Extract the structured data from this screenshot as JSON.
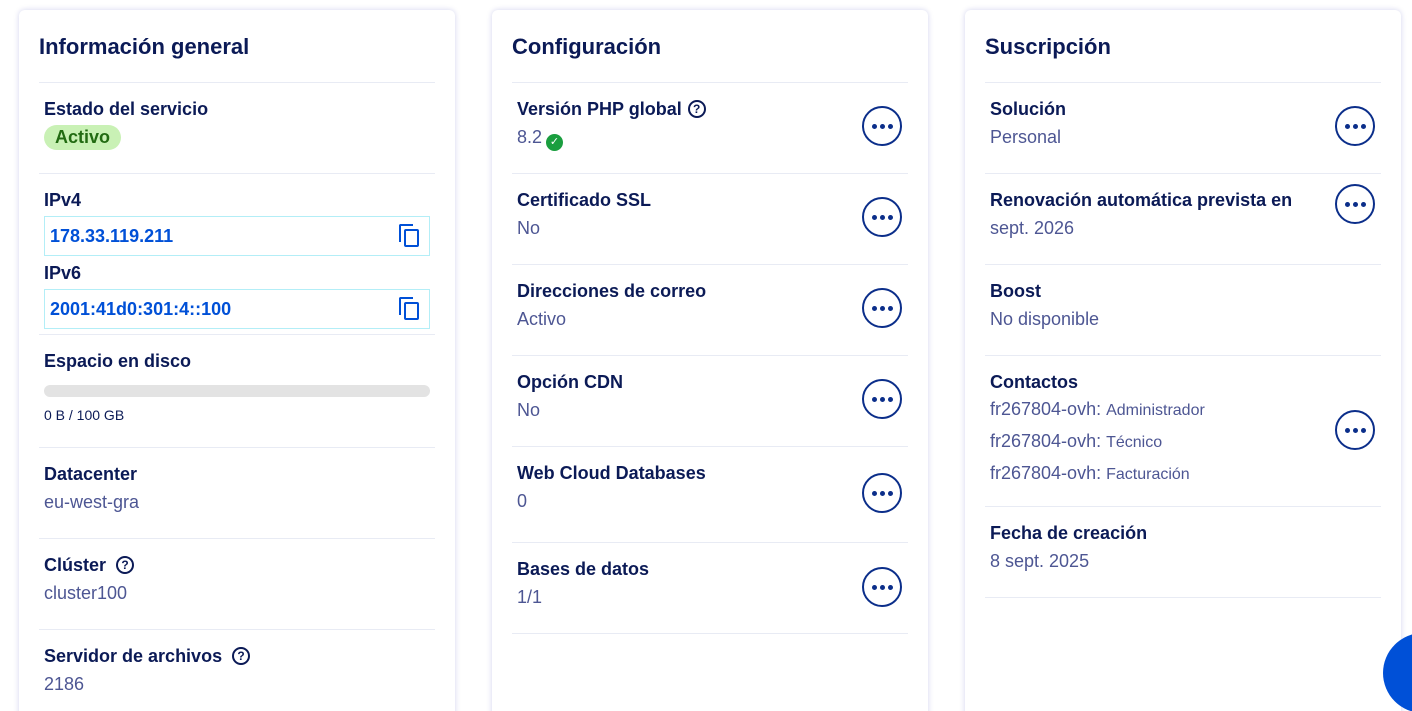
{
  "general": {
    "title": "Información general",
    "status": {
      "label": "Estado del servicio",
      "value": "Activo"
    },
    "ipv4": {
      "label": "IPv4",
      "value": "178.33.119.211"
    },
    "ipv6": {
      "label": "IPv6",
      "value": "2001:41d0:301:4::100"
    },
    "disk": {
      "label": "Espacio en disco",
      "usage_text": "0 B / 100 GB",
      "used_fraction": 0
    },
    "datacenter": {
      "label": "Datacenter",
      "value": "eu-west-gra"
    },
    "cluster": {
      "label": "Clúster",
      "value": "cluster100"
    },
    "fileserver": {
      "label": "Servidor de archivos",
      "value": "2186"
    }
  },
  "config": {
    "title": "Configuración",
    "php": {
      "label": "Versión PHP global",
      "value": "8.2"
    },
    "ssl": {
      "label": "Certificado SSL",
      "value": "No"
    },
    "mail": {
      "label": "Direcciones de correo",
      "value": "Activo"
    },
    "cdn": {
      "label": "Opción CDN",
      "value": "No"
    },
    "webdb": {
      "label": "Web Cloud Databases",
      "value": "0"
    },
    "db": {
      "label": "Bases de datos",
      "value": "1/1"
    }
  },
  "subscription": {
    "title": "Suscripción",
    "solution": {
      "label": "Solución",
      "value": "Personal"
    },
    "renewal": {
      "label": "Renovación automática prevista en",
      "value": "sept. 2026"
    },
    "boost": {
      "label": "Boost",
      "value": "No disponible"
    },
    "contacts": {
      "label": "Contactos",
      "items": [
        {
          "id": "fr267804-ovh:",
          "role": "Administrador"
        },
        {
          "id": "fr267804-ovh:",
          "role": "Técnico"
        },
        {
          "id": "fr267804-ovh:",
          "role": "Facturación"
        }
      ]
    },
    "created": {
      "label": "Fecha de creación",
      "value": "8 sept. 2025"
    }
  },
  "icons": {
    "help": "question-mark-circle",
    "copy": "copy-icon",
    "menu": "ellipsis-circle",
    "check": "check-circle",
    "help_glyph": "?",
    "check_glyph": "✓"
  },
  "colors": {
    "primary": "#0050d7",
    "heading": "#0b1a56",
    "muted": "#4d5693",
    "success": "#1a9e3f",
    "badge_bg": "#c9f1b5"
  }
}
